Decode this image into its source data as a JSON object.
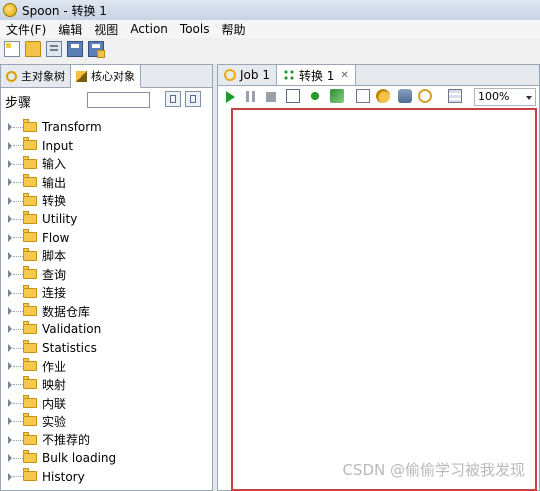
{
  "window": {
    "title": "Spoon - 转换 1"
  },
  "menu": [
    "文件(F)",
    "编辑",
    "视图",
    "Action",
    "Tools",
    "帮助"
  ],
  "left_panel": {
    "tabs": [
      {
        "label": "主对象树",
        "icon": "main-object-tree-icon"
      },
      {
        "label": "核心对象",
        "icon": "core-objects-icon",
        "active": true
      }
    ],
    "steps_label": "步骤",
    "search_value": "",
    "tree_items": [
      "Transform",
      "Input",
      "输入",
      "输出",
      "转换",
      "Utility",
      "Flow",
      "脚本",
      "查询",
      "连接",
      "数据仓库",
      "Validation",
      "Statistics",
      "作业",
      "映射",
      "内联",
      "实验",
      "不推荐的",
      "Bulk loading",
      "History"
    ]
  },
  "right_panel": {
    "tabs": [
      {
        "label": "Job 1",
        "icon": "job-icon"
      },
      {
        "label": "转换 1",
        "icon": "transformation-icon",
        "active": true
      }
    ],
    "zoom": "100%"
  },
  "watermark": "CSDN @偷偷学习被我发现"
}
